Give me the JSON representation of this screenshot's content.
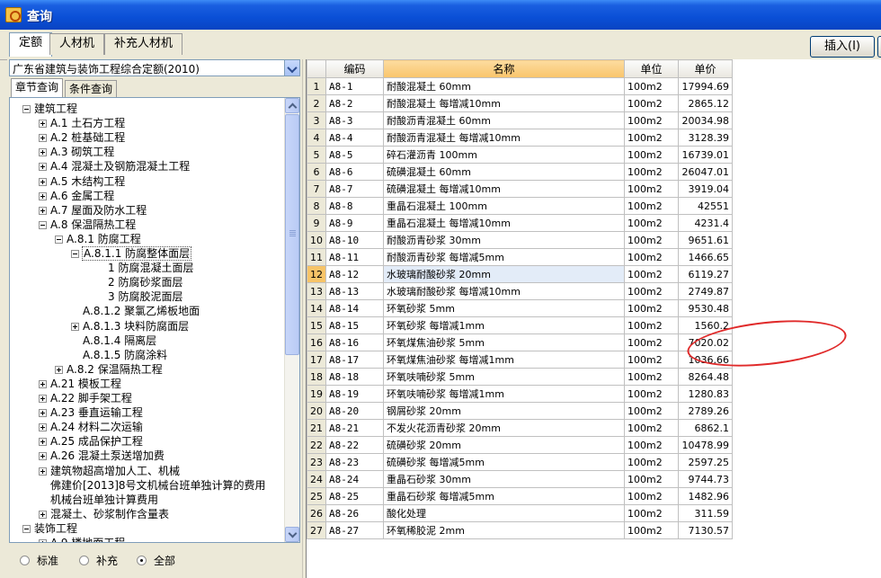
{
  "window": {
    "title": "查询"
  },
  "tabs": [
    "定额",
    "人材机",
    "补充人材机"
  ],
  "insert_button": "插入(I)",
  "quota_library": "广东省建筑与装饰工程综合定额(2010)",
  "subtabs": [
    "章节查询",
    "条件查询"
  ],
  "tree": [
    {
      "label": "建筑工程",
      "level": 0,
      "toggle": "minus"
    },
    {
      "label": "A.1 土石方工程",
      "level": 1,
      "toggle": "plus"
    },
    {
      "label": "A.2 桩基础工程",
      "level": 1,
      "toggle": "plus"
    },
    {
      "label": "A.3 砌筑工程",
      "level": 1,
      "toggle": "plus"
    },
    {
      "label": "A.4 混凝土及钢筋混凝土工程",
      "level": 1,
      "toggle": "plus"
    },
    {
      "label": "A.5 木结构工程",
      "level": 1,
      "toggle": "plus"
    },
    {
      "label": "A.6 金属工程",
      "level": 1,
      "toggle": "plus"
    },
    {
      "label": "A.7 屋面及防水工程",
      "level": 1,
      "toggle": "plus"
    },
    {
      "label": "A.8 保温隔热工程",
      "level": 1,
      "toggle": "minus"
    },
    {
      "label": "A.8.1 防腐工程",
      "level": 2,
      "toggle": "minus"
    },
    {
      "label": "A.8.1.1 防腐整体面层",
      "level": 3,
      "toggle": "minus",
      "selected": true
    },
    {
      "label": "1 防腐混凝土面层",
      "level": 4,
      "toggle": ""
    },
    {
      "label": "2 防腐砂浆面层",
      "level": 4,
      "toggle": ""
    },
    {
      "label": "3 防腐胶泥面层",
      "level": 4,
      "toggle": ""
    },
    {
      "label": "A.8.1.2 聚氯乙烯板地面",
      "level": 3,
      "toggle": ""
    },
    {
      "label": "A.8.1.3 块料防腐面层",
      "level": 3,
      "toggle": "plus"
    },
    {
      "label": "A.8.1.4 隔离层",
      "level": 3,
      "toggle": ""
    },
    {
      "label": "A.8.1.5 防腐涂料",
      "level": 3,
      "toggle": ""
    },
    {
      "label": "A.8.2 保温隔热工程",
      "level": 2,
      "toggle": "plus"
    },
    {
      "label": "A.21 模板工程",
      "level": 1,
      "toggle": "plus"
    },
    {
      "label": "A.22 脚手架工程",
      "level": 1,
      "toggle": "plus"
    },
    {
      "label": "A.23 垂直运输工程",
      "level": 1,
      "toggle": "plus"
    },
    {
      "label": "A.24 材料二次运输",
      "level": 1,
      "toggle": "plus"
    },
    {
      "label": "A.25 成品保护工程",
      "level": 1,
      "toggle": "plus"
    },
    {
      "label": "A.26 混凝土泵送增加费",
      "level": 1,
      "toggle": "plus"
    },
    {
      "label": "建筑物超高增加人工、机械",
      "level": 1,
      "toggle": "plus"
    },
    {
      "label": "佛建价[2013]8号文机械台班单独计算的费用",
      "level": 1,
      "toggle": ""
    },
    {
      "label": "机械台班单独计算费用",
      "level": 1,
      "toggle": ""
    },
    {
      "label": "混凝土、砂浆制作含量表",
      "level": 1,
      "toggle": "plus"
    },
    {
      "label": "装饰工程",
      "level": 0,
      "toggle": "minus"
    },
    {
      "label": "A.9 楼地面工程",
      "level": 1,
      "toggle": "plus"
    }
  ],
  "filter": {
    "options": [
      "标准",
      "补充",
      "全部"
    ],
    "selected": "全部"
  },
  "grid": {
    "headers": [
      "",
      "编码",
      "名称",
      "单位",
      "单价"
    ],
    "selected_row": 12,
    "rows": [
      [
        "1",
        "A8-1",
        "耐酸混凝土 60mm",
        "100m2",
        "17994.69"
      ],
      [
        "2",
        "A8-2",
        "耐酸混凝土 每增减10mm",
        "100m2",
        "2865.12"
      ],
      [
        "3",
        "A8-3",
        "耐酸沥青混凝土 60mm",
        "100m2",
        "20034.98"
      ],
      [
        "4",
        "A8-4",
        "耐酸沥青混凝土 每增减10mm",
        "100m2",
        "3128.39"
      ],
      [
        "5",
        "A8-5",
        "碎石灌沥青 100mm",
        "100m2",
        "16739.01"
      ],
      [
        "6",
        "A8-6",
        "硫磺混凝土 60mm",
        "100m2",
        "26047.01"
      ],
      [
        "7",
        "A8-7",
        "硫磺混凝土 每增减10mm",
        "100m2",
        "3919.04"
      ],
      [
        "8",
        "A8-8",
        "重晶石混凝土 100mm",
        "100m2",
        "42551"
      ],
      [
        "9",
        "A8-9",
        "重晶石混凝土 每增减10mm",
        "100m2",
        "4231.4"
      ],
      [
        "10",
        "A8-10",
        "耐酸沥青砂浆 30mm",
        "100m2",
        "9651.61"
      ],
      [
        "11",
        "A8-11",
        "耐酸沥青砂浆 每增减5mm",
        "100m2",
        "1466.65"
      ],
      [
        "12",
        "A8-12",
        "水玻璃耐酸砂浆 20mm",
        "100m2",
        "6119.27"
      ],
      [
        "13",
        "A8-13",
        "水玻璃耐酸砂浆 每增减10mm",
        "100m2",
        "2749.87"
      ],
      [
        "14",
        "A8-14",
        "环氧砂浆 5mm",
        "100m2",
        "9530.48"
      ],
      [
        "15",
        "A8-15",
        "环氧砂浆 每增减1mm",
        "100m2",
        "1560.2"
      ],
      [
        "16",
        "A8-16",
        "环氧煤焦油砂浆 5mm",
        "100m2",
        "7020.02"
      ],
      [
        "17",
        "A8-17",
        "环氧煤焦油砂浆 每增减1mm",
        "100m2",
        "1036.66"
      ],
      [
        "18",
        "A8-18",
        "环氧呋喃砂浆 5mm",
        "100m2",
        "8264.48"
      ],
      [
        "19",
        "A8-19",
        "环氧呋喃砂浆 每增减1mm",
        "100m2",
        "1280.83"
      ],
      [
        "20",
        "A8-20",
        "钢屑砂浆 20mm",
        "100m2",
        "2789.26"
      ],
      [
        "21",
        "A8-21",
        "不发火花沥青砂浆 20mm",
        "100m2",
        "6862.1"
      ],
      [
        "22",
        "A8-22",
        "硫磺砂浆 20mm",
        "100m2",
        "10478.99"
      ],
      [
        "23",
        "A8-23",
        "硫磺砂浆 每增减5mm",
        "100m2",
        "2597.25"
      ],
      [
        "24",
        "A8-24",
        "重晶石砂浆 30mm",
        "100m2",
        "9744.73"
      ],
      [
        "25",
        "A8-25",
        "重晶石砂浆 每增减5mm",
        "100m2",
        "1482.96"
      ],
      [
        "26",
        "A8-26",
        "酸化处理",
        "100m2",
        "311.59"
      ],
      [
        "27",
        "A8-27",
        "环氧稀胶泥 2mm",
        "100m2",
        "7130.57"
      ]
    ]
  }
}
